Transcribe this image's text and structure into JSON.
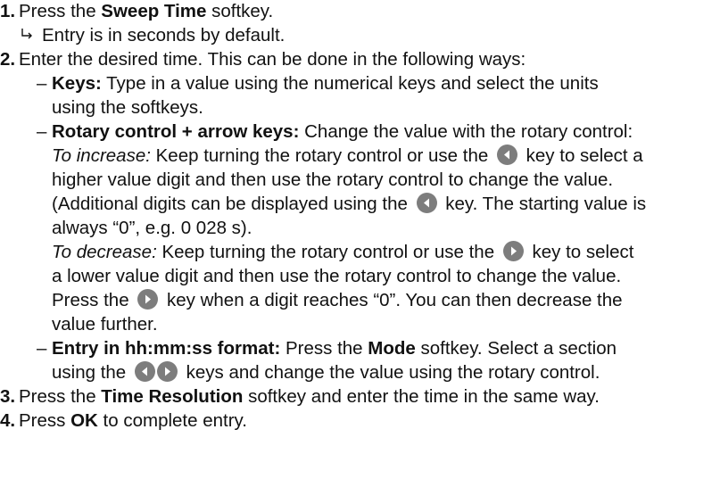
{
  "steps": [
    {
      "number": "1.",
      "text_pre": "Press the ",
      "bold": "Sweep Time",
      "text_post": " softkey.",
      "result_icon": "right-hook-arrow-icon",
      "result_text": "Entry is in seconds by default."
    },
    {
      "number": "2.",
      "text": "Enter the desired time. This can be done in the following ways:",
      "bullets": {
        "dash": "–",
        "keys": {
          "label": "Keys:",
          "line1": " Type in a value using the numerical keys and select the units",
          "line2": "using the softkeys."
        },
        "rotary": {
          "label": "Rotary control + arrow keys:",
          "line1": " Change the value with the rotary control:",
          "increase_label": "To increase:",
          "increase_line1a": " Keep turning the rotary control or use the ",
          "increase_line1b": " key to select a",
          "increase_line2": "higher value digit and then use the rotary control to change the value.",
          "increase_line3a": "(Additional digits can be displayed using the ",
          "increase_line3b": " key. The starting value is",
          "increase_line4": "always “0”, e.g. 0 028 s).",
          "decrease_label": "To decrease:",
          "decrease_line1a": " Keep turning the rotary control or use the ",
          "decrease_line1b": " key to select",
          "decrease_line2": "a lower value digit and then use the rotary control to change the value.",
          "decrease_line3a": "Press the ",
          "decrease_line3b": " key when a digit reaches “0”. You can then decrease the",
          "decrease_line4": "value further."
        },
        "hhmmss": {
          "label": "Entry in hh:mm:ss format:",
          "line1a": " Press the ",
          "mode_bold": "Mode",
          "line1b": " softkey. Select a section",
          "line2a": "using the ",
          "line2b": " keys and change the value using the rotary control."
        }
      }
    },
    {
      "number": "3.",
      "text_pre": "Press the ",
      "bold": "Time Resolution",
      "text_post": " softkey and enter the time in the same way."
    },
    {
      "number": "4.",
      "text_pre": "Press ",
      "bold": "OK",
      "text_post": " to complete entry."
    }
  ],
  "icons": {
    "left": "left-arrow-key-icon",
    "right": "right-arrow-key-icon",
    "key_color": "#7d7d7d"
  }
}
